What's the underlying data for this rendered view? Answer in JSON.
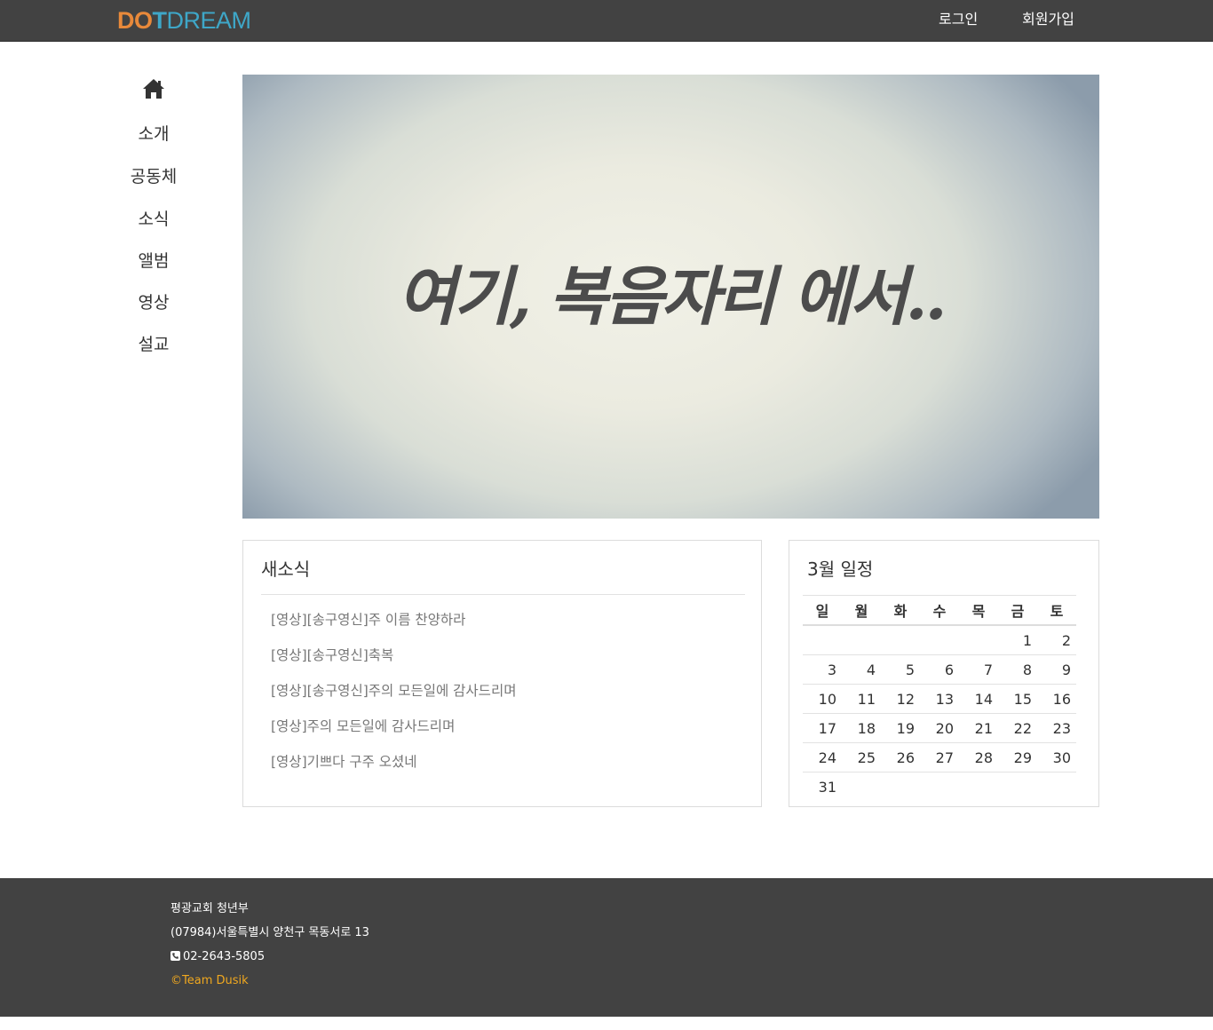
{
  "header": {
    "logo": {
      "part1": "DO",
      "part2": "T",
      "part3": "DREAM"
    },
    "login_label": "로그인",
    "signup_label": "회원가입"
  },
  "sidebar": {
    "home_icon": "home-icon",
    "items": [
      {
        "label": "소개"
      },
      {
        "label": "공동체"
      },
      {
        "label": "소식"
      },
      {
        "label": "앨범"
      },
      {
        "label": "영상"
      },
      {
        "label": "설교"
      }
    ]
  },
  "hero": {
    "text": "여기, 복음자리 에서.."
  },
  "news": {
    "title": "새소식",
    "items": [
      "[영상][송구영신]주 이름 찬양하라",
      "[영상][송구영신]축복",
      "[영상][송구영신]주의 모든일에 감사드리며",
      "[영상]주의 모든일에 감사드리며",
      "[영상]기쁘다 구주 오셨네"
    ]
  },
  "schedule": {
    "title": "3월 일정",
    "weekdays": [
      "일",
      "월",
      "화",
      "수",
      "목",
      "금",
      "토"
    ],
    "weeks": [
      [
        "",
        "",
        "",
        "",
        "",
        "1",
        "2"
      ],
      [
        "3",
        "4",
        "5",
        "6",
        "7",
        "8",
        "9"
      ],
      [
        "10",
        "11",
        "12",
        "13",
        "14",
        "15",
        "16"
      ],
      [
        "17",
        "18",
        "19",
        "20",
        "21",
        "22",
        "23"
      ],
      [
        "24",
        "25",
        "26",
        "27",
        "28",
        "29",
        "30"
      ],
      [
        "31",
        "",
        "",
        "",
        "",
        "",
        ""
      ]
    ]
  },
  "footer": {
    "org": "평광교회 청년부",
    "address": "(07984)서울특별시 양천구 목동서로 13",
    "phone": "02-2643-5805",
    "phone_icon": "phone-icon",
    "copyright": "©Team Dusik"
  },
  "colors": {
    "topbar": "#424242",
    "logo_orange": "#e8893a",
    "logo_blue": "#3ea7c8",
    "copyright": "#f0a81f"
  }
}
